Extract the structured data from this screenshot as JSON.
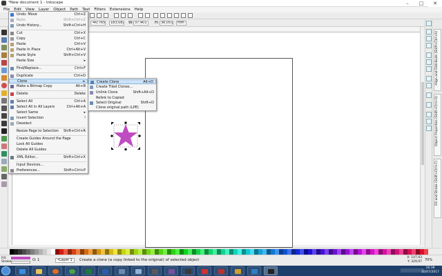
{
  "window": {
    "title": "*New document 1 - Inkscape",
    "minimize": "–",
    "maximize": "□",
    "close": "✕"
  },
  "menubar": [
    "File",
    "Edit",
    "View",
    "Layer",
    "Object",
    "Path",
    "Text",
    "Filters",
    "Extensions",
    "Help"
  ],
  "toolctl": {
    "x_value": "-40,765",
    "y_value": "183,082",
    "w_label": "W:",
    "w_value": "37,401",
    "h_label": "H:",
    "h_value": "36,051",
    "unit": "mm"
  },
  "edit_menu": {
    "items": [
      {
        "label": "Undo: Move",
        "shortcut": "Ctrl+Z",
        "disabled": false
      },
      {
        "label": "Redo",
        "shortcut": "Shift+Ctrl+Z",
        "disabled": true
      },
      {
        "label": "Undo History...",
        "shortcut": "Shift+Ctrl+H",
        "disabled": false
      },
      {
        "label": "Cut",
        "shortcut": "Ctrl+X",
        "disabled": false
      },
      {
        "label": "Copy",
        "shortcut": "Ctrl+C",
        "disabled": false
      },
      {
        "label": "Paste",
        "shortcut": "Ctrl+V",
        "disabled": false
      },
      {
        "label": "Paste In Place",
        "shortcut": "Ctrl+Alt+V",
        "disabled": false
      },
      {
        "label": "Paste Style",
        "shortcut": "Shift+Ctrl+V",
        "disabled": false
      },
      {
        "label": "Paste Size",
        "shortcut": "",
        "disabled": false
      },
      {
        "label": "Find/Replace...",
        "shortcut": "Ctrl+F",
        "disabled": false
      },
      {
        "label": "Duplicate",
        "shortcut": "Ctrl+D",
        "disabled": false
      },
      {
        "label": "Clone",
        "shortcut": "",
        "disabled": false
      },
      {
        "label": "Make a Bitmap Copy",
        "shortcut": "Alt+B",
        "disabled": false
      },
      {
        "label": "Delete",
        "shortcut": "Delete",
        "disabled": false
      },
      {
        "label": "Select All",
        "shortcut": "Ctrl+A",
        "disabled": false
      },
      {
        "label": "Select All in All Layers",
        "shortcut": "Ctrl+Alt+A",
        "disabled": false
      },
      {
        "label": "Select Same",
        "shortcut": "",
        "disabled": false
      },
      {
        "label": "Invert Selection",
        "shortcut": "!",
        "disabled": false
      },
      {
        "label": "Deselect",
        "shortcut": "",
        "disabled": false
      },
      {
        "label": "Resize Page to Selection",
        "shortcut": "Shift+Ctrl+R",
        "disabled": false
      },
      {
        "label": "Create Guides Around the Page",
        "shortcut": "",
        "disabled": false
      },
      {
        "label": "Lock All Guides",
        "shortcut": "",
        "disabled": false
      },
      {
        "label": "Delete All Guides",
        "shortcut": "",
        "disabled": false
      },
      {
        "label": "XML Editor...",
        "shortcut": "Shift+Ctrl+X",
        "disabled": false
      },
      {
        "label": "Input Devices...",
        "shortcut": "",
        "disabled": false
      },
      {
        "label": "Preferences...",
        "shortcut": "Shift+Ctrl+P",
        "disabled": false
      }
    ]
  },
  "clone_menu": {
    "items": [
      {
        "label": "Create Clone",
        "shortcut": "Alt+D"
      },
      {
        "label": "Create Tiled Clones...",
        "shortcut": ""
      },
      {
        "label": "Unlink Clone",
        "shortcut": "Shift+Alt+D"
      },
      {
        "label": "Relink to Copied",
        "shortcut": ""
      },
      {
        "label": "Select Original",
        "shortcut": "Shift+D"
      },
      {
        "label": "Clone original path (LPE)",
        "shortcut": ""
      }
    ]
  },
  "dock_tabs": [
    "Align and Distribute (Shift+Ctrl+A)",
    "Object Properties (Shift+Ctrl+O)",
    "Fill and Stroke (Shift+Ctrl+F)"
  ],
  "status": {
    "fill_label": "Fill:",
    "stroke_label": "Stroke:",
    "stroke_value": "None",
    "opacity_label": "O:",
    "opacity_value": "1",
    "layer": "•Layer 1",
    "message": "Create a clone (a copy linked to the original) of selected object",
    "x_coord": "X: 147,93",
    "y_coord": "Y: 329,97",
    "zoom": "70%"
  },
  "taskbar": {
    "time": "16:38",
    "date": "10/07/2017"
  },
  "colors": {
    "star_fill": "#c04cc1",
    "menu_highlight": "#cde3f7",
    "taskbar": "#1d3f6a"
  }
}
